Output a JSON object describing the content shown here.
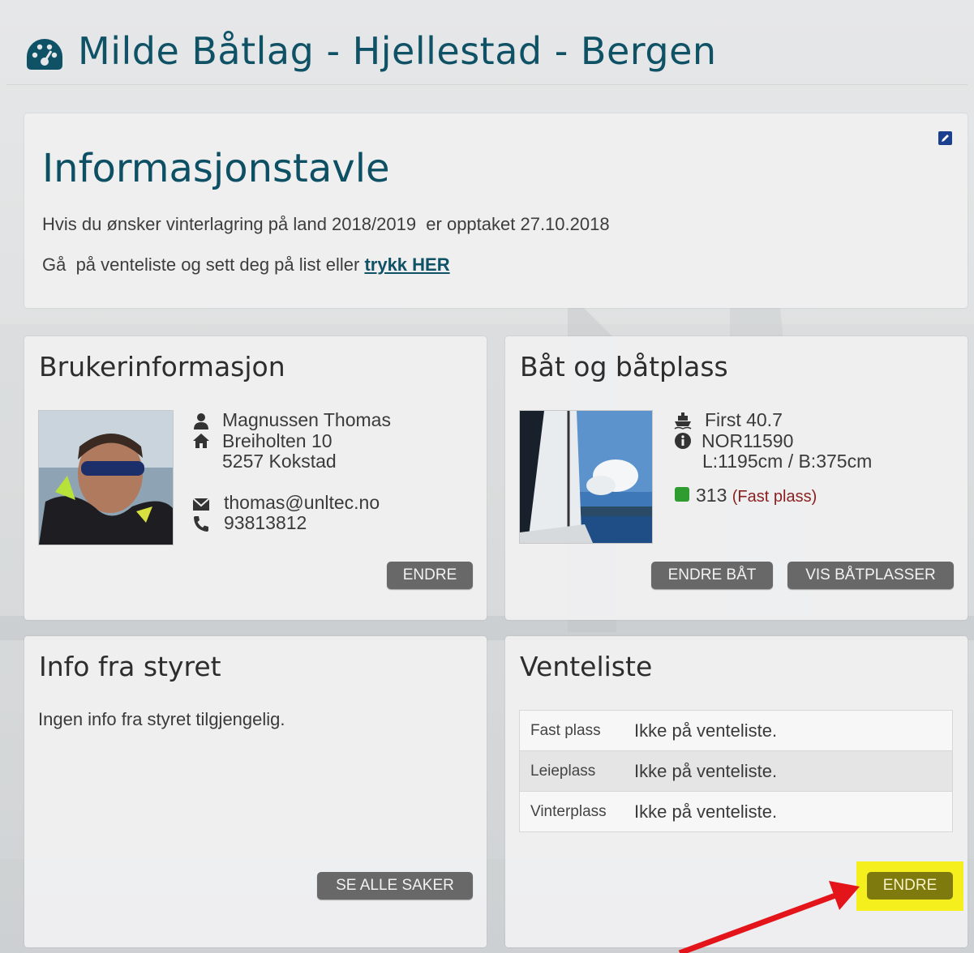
{
  "header": {
    "title": "Milde Båtlag - Hjellestad - Bergen",
    "icon": "dashboard-gauge-icon"
  },
  "info_board": {
    "title": "Informasjonstavle",
    "line1": "Hvis du ønsker vinterlagring på land 2018/2019  er opptaket 27.10.2018",
    "line2_prefix": "Gå  på venteliste og sett deg på list eller ",
    "line2_link": "trykk HER"
  },
  "user": {
    "title": "Brukerinformasjon",
    "name": "Magnussen Thomas",
    "street": "Breiholten 10",
    "postal": "5257 Kokstad",
    "email": "thomas@unltec.no",
    "phone": "93813812",
    "edit_label": "ENDRE"
  },
  "boat": {
    "title": "Båt og båtplass",
    "model": "First 40.7",
    "reg": "NOR11590",
    "dimensions": "L:1195cm / B:375cm",
    "berth_number": "313",
    "berth_type": "(Fast plass)",
    "berth_color": "#2e9c2e",
    "edit_boat_label": "ENDRE BÅT",
    "show_berths_label": "VIS BÅTPLASSER"
  },
  "board_info": {
    "title": "Info fra styret",
    "text": "Ingen info fra styret tilgjengelig.",
    "see_all_label": "SE ALLE SAKER"
  },
  "waitlist": {
    "title": "Venteliste",
    "rows": [
      {
        "label": "Fast plass",
        "value": "Ikke på venteliste."
      },
      {
        "label": "Leieplass",
        "value": "Ikke på venteliste."
      },
      {
        "label": "Vinterplass",
        "value": "Ikke på venteliste."
      }
    ],
    "edit_label": "ENDRE",
    "highlight_color": "#f5ef1d"
  },
  "colors": {
    "brand": "#0f5266",
    "button": "#686868",
    "annotation_arrow": "#e3141a"
  }
}
